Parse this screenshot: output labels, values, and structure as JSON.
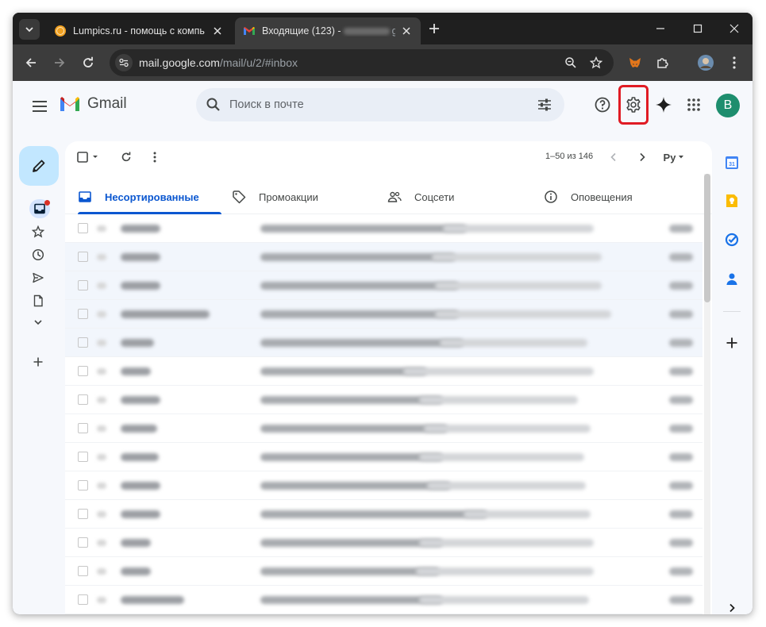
{
  "browser": {
    "tabs": [
      {
        "title": "Lumpics.ru - помощь с компь",
        "favicon": "lumpics-favicon",
        "active": false
      },
      {
        "title": "Входящие (123) -",
        "title_suffix": "g",
        "favicon": "gmail-favicon",
        "active": true
      }
    ],
    "url_host": "mail.google.com",
    "url_path": "/mail/u/2/#inbox"
  },
  "gmail": {
    "logo_text": "Gmail",
    "search_placeholder": "Поиск в почте",
    "avatar_letter": "B",
    "pagination": "1–50 из 146",
    "input_lang": "Ру",
    "tabs": [
      {
        "label": "Несортированные",
        "icon": "inbox-icon",
        "selected": true
      },
      {
        "label": "Промоакции",
        "icon": "tag-icon",
        "selected": false
      },
      {
        "label": "Соцсети",
        "icon": "people-icon",
        "selected": false
      },
      {
        "label": "Оповещения",
        "icon": "info-icon",
        "selected": false
      }
    ],
    "left_nav": [
      "inbox-icon",
      "star-icon",
      "clock-icon",
      "send-icon",
      "draft-icon",
      "expand-icon",
      "add-label-icon"
    ],
    "side_apps": [
      "calendar-icon",
      "keep-icon",
      "tasks-icon",
      "contacts-icon",
      "add-app-icon"
    ],
    "rows": [
      {
        "read": false
      },
      {
        "read": true
      },
      {
        "read": true
      },
      {
        "read": true
      },
      {
        "read": true
      },
      {
        "read": false
      },
      {
        "read": false
      },
      {
        "read": false
      },
      {
        "read": false
      },
      {
        "read": false
      },
      {
        "read": false
      },
      {
        "read": false
      },
      {
        "read": false
      },
      {
        "read": false
      }
    ]
  },
  "colors": {
    "accent": "#0b57d0",
    "highlight": "#e01b24",
    "avatar_bg": "#1e8e6e"
  }
}
